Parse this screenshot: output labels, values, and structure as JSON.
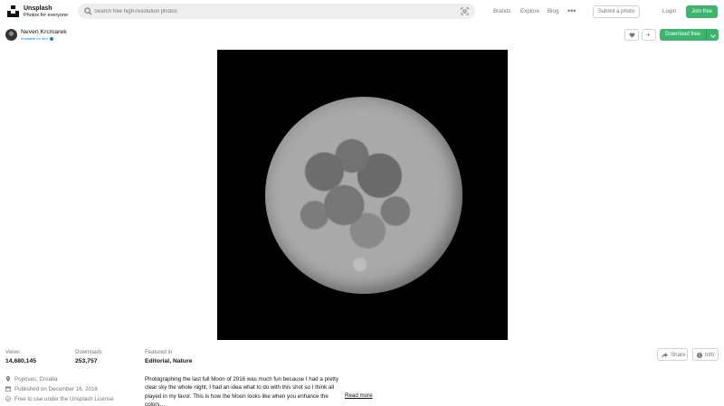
{
  "header": {
    "brand_name": "Unsplash",
    "brand_tagline": "Photos for everyone",
    "search_placeholder": "Search free high-resolution photos",
    "nav": [
      "Brands",
      "Explore",
      "Blog"
    ],
    "more_label": "•••",
    "submit_label": "Submit a photo",
    "login_label": "Login",
    "join_label": "Join free"
  },
  "photographer": {
    "name": "Neven Krcmarek",
    "status": "Available for hire"
  },
  "actions": {
    "download_label": "Download free"
  },
  "stats": {
    "views_label": "Views",
    "views_value": "14,680,145",
    "downloads_label": "Downloads",
    "downloads_value": "253,757",
    "featured_label": "Featured in",
    "featured_value": "Editorial, Nature"
  },
  "buttons": {
    "share_label": "Share",
    "info_label": "Info"
  },
  "meta": {
    "location": "Popovec, Croatia",
    "published": "Published on December 16, 2016",
    "license": "Free to use under the Unsplash License"
  },
  "description": {
    "text": "Photographing the last full Moon of 2016 was much fun because I had a pretty clear sky the whole night. I had an idea what to do with this shot so I think all played in my favor. This is how the Moon looks like when you enhance the colors…",
    "read_more": "Read more"
  },
  "colors": {
    "accent_green": "#3cb46e",
    "hire_blue": "#007fff"
  }
}
